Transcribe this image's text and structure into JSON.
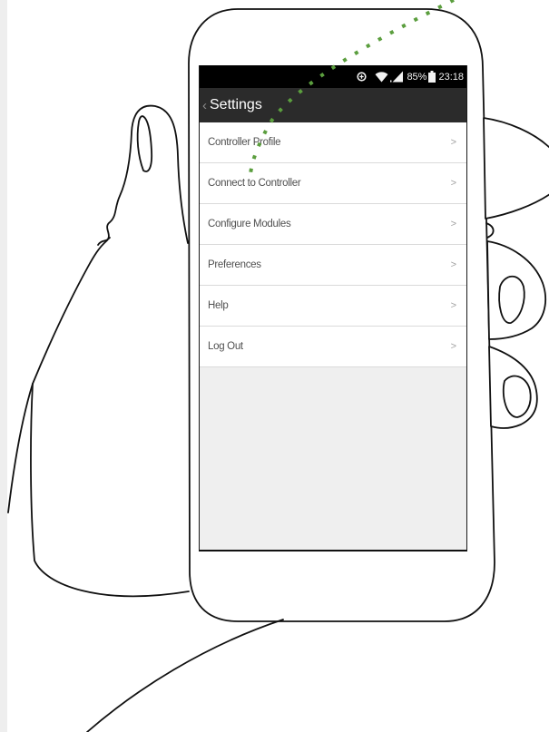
{
  "status_bar": {
    "icons": [
      "data-saver-icon",
      "wifi-icon",
      "signal-icon",
      "battery-icon"
    ],
    "battery_percent": "85%",
    "time": "23:18"
  },
  "action_bar": {
    "back_glyph": "‹",
    "title": "Settings"
  },
  "settings_menu": {
    "items": [
      {
        "label": "Controller Profile",
        "chevron": ">"
      },
      {
        "label": "Connect to Controller",
        "chevron": ">"
      },
      {
        "label": "Configure Modules",
        "chevron": ">"
      },
      {
        "label": "Preferences",
        "chevron": ">"
      },
      {
        "label": "Help",
        "chevron": ">"
      },
      {
        "label": "Log Out",
        "chevron": ">"
      }
    ]
  },
  "colors": {
    "status_bar": "#000000",
    "action_bar": "#2b2b2b",
    "list_background": "#ffffff",
    "empty_area": "#efefef",
    "divider": "#dadada",
    "callout": "#5b9e3e"
  }
}
